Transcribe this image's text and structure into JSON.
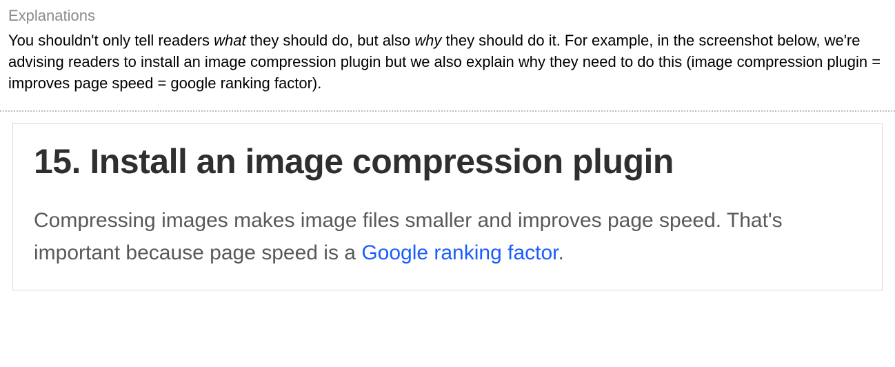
{
  "section": {
    "label": "Explanations",
    "paragraph": {
      "part1": "You shouldn't only tell readers ",
      "em1": "what",
      "part2": " they should do, but also ",
      "em2": "why",
      "part3": " they should do it. For example, in the screenshot below, we're advising readers to install an image compression plugin but we also explain why they need to do this (image compression plugin = improves page speed = google ranking factor)."
    }
  },
  "embedded": {
    "heading": "15. Install an image compression plugin",
    "paragraph": {
      "part1": "Compressing images makes image files smaller and improves page speed. That's important because page speed is a ",
      "link": "Google ranking factor",
      "part2": "."
    }
  }
}
